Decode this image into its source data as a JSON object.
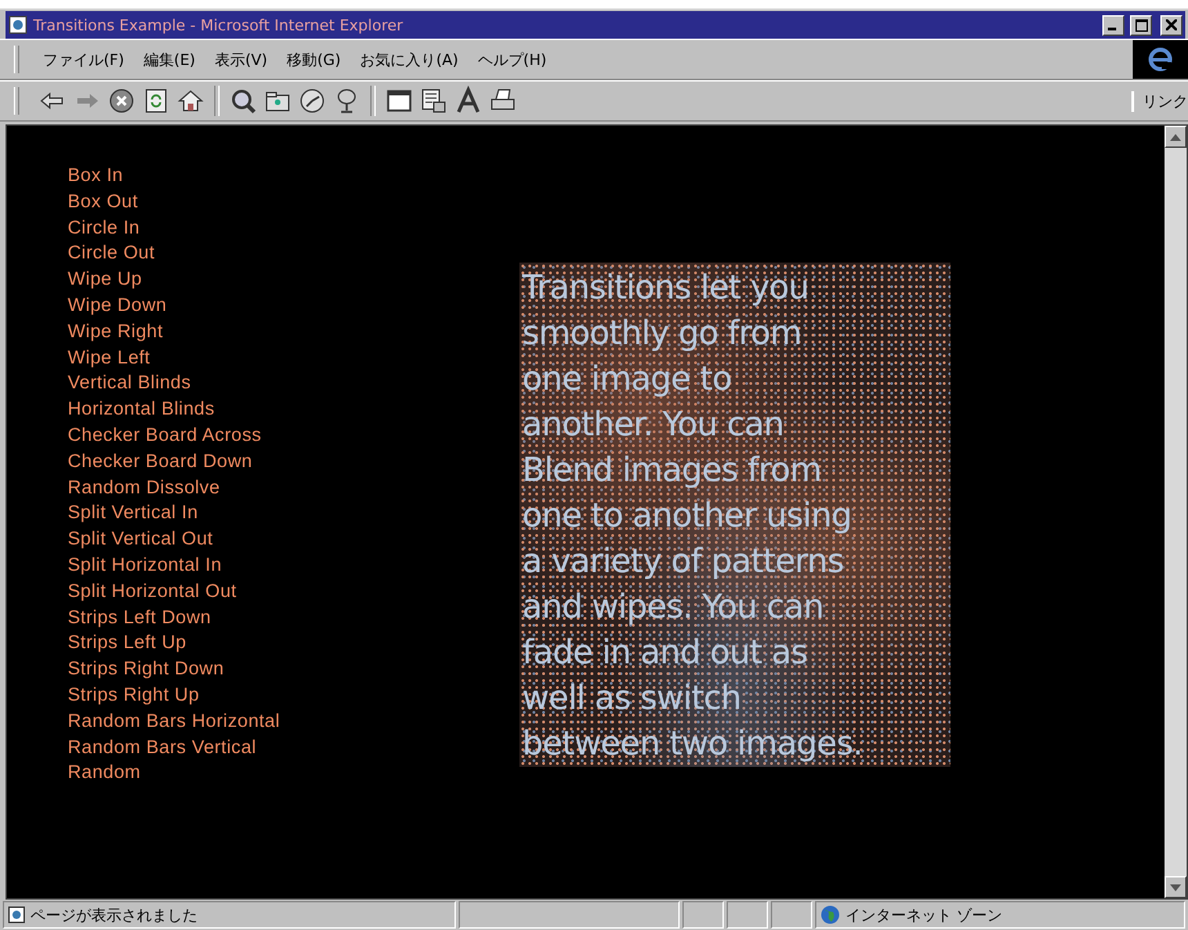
{
  "window": {
    "title": "Transitions Example - Microsoft Internet Explorer"
  },
  "menu": [
    "ファイル(F)",
    "編集(E)",
    "表示(V)",
    "移動(G)",
    "お気に入り(A)",
    "ヘルプ(H)"
  ],
  "toolbar": {
    "links_label": "リンク"
  },
  "transitions": [
    "Box In",
    "Box Out",
    "Circle In",
    "Circle Out",
    "Wipe Up",
    "Wipe Down",
    "Wipe Right",
    "Wipe Left",
    "Vertical Blinds",
    "Horizontal Blinds",
    "Checker Board Across",
    "Checker Board Down",
    "Random Dissolve",
    "Split Vertical In",
    "Split Vertical Out",
    "Split Horizontal In",
    "Split Horizontal Out",
    "Strips Left Down",
    "Strips Left Up",
    "Strips Right Down",
    "Strips Right Up",
    "Random Bars Horizontal",
    "Random Bars Vertical",
    "Random"
  ],
  "panel": {
    "lines": [
      "Transitions let you",
      "smoothly go from",
      "one image to",
      "another. You can",
      "Blend images from",
      "one to another using",
      "a variety of patterns",
      "and wipes. You can",
      "fade in and out as",
      "well as switch",
      "between two images."
    ]
  },
  "status_bar": {
    "message": "ページが表示されました",
    "zone": "インターネット ゾーン"
  }
}
